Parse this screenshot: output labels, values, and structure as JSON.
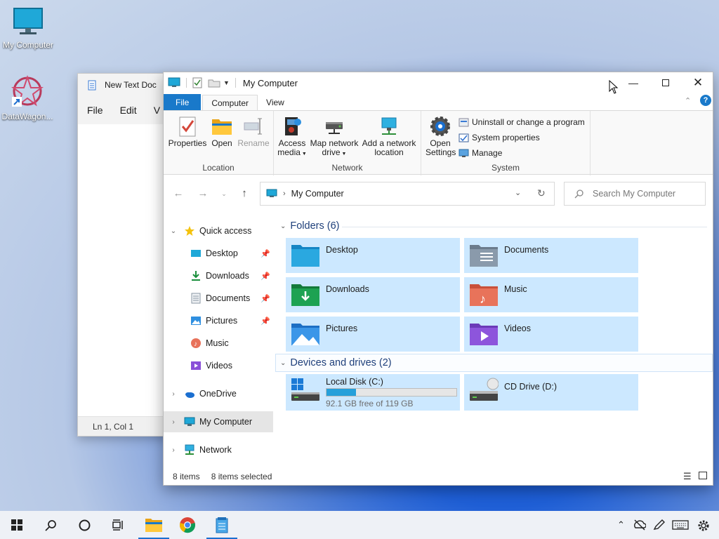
{
  "desktop": {
    "icons": [
      {
        "label": "My Computer",
        "icon": "monitor-icon"
      },
      {
        "label": "DataWagon...",
        "icon": "datawagon-app-icon"
      }
    ]
  },
  "notepad": {
    "title": "New Text Doc",
    "menu": [
      "File",
      "Edit",
      "V"
    ],
    "status": "Ln 1, Col 1"
  },
  "explorer": {
    "title": "My Computer",
    "tabs": {
      "file": "File",
      "computer": "Computer",
      "view": "View"
    },
    "ribbon": {
      "location": {
        "label": "Location",
        "properties": "Properties",
        "open": "Open",
        "rename": "Rename"
      },
      "network": {
        "label": "Network",
        "access_media": "Access",
        "access_media2": "media",
        "map_drive": "Map network",
        "map_drive2": "drive",
        "add_location": "Add a network",
        "add_location2": "location"
      },
      "system": {
        "label": "System",
        "open_settings": "Open",
        "open_settings2": "Settings",
        "uninstall": "Uninstall or change a program",
        "system_properties": "System properties",
        "manage": "Manage"
      }
    },
    "address": {
      "path": "My Computer"
    },
    "search": {
      "placeholder": "Search My Computer"
    },
    "tree": {
      "quick_access": "Quick access",
      "items": [
        {
          "label": "Desktop",
          "icon": "desktop-folder-icon"
        },
        {
          "label": "Downloads",
          "icon": "downloads-icon"
        },
        {
          "label": "Documents",
          "icon": "documents-icon"
        },
        {
          "label": "Pictures",
          "icon": "pictures-icon"
        },
        {
          "label": "Music",
          "icon": "music-icon"
        },
        {
          "label": "Videos",
          "icon": "videos-icon"
        }
      ],
      "onedrive": "OneDrive",
      "my_computer": "My Computer",
      "network": "Network"
    },
    "folders_header": "Folders (6)",
    "folders": [
      {
        "name": "Desktop",
        "icon": "desktop-folder-icon"
      },
      {
        "name": "Documents",
        "icon": "documents-folder-icon"
      },
      {
        "name": "Downloads",
        "icon": "downloads-folder-icon"
      },
      {
        "name": "Music",
        "icon": "music-folder-icon"
      },
      {
        "name": "Pictures",
        "icon": "pictures-folder-icon"
      },
      {
        "name": "Videos",
        "icon": "videos-folder-icon"
      }
    ],
    "drives_header": "Devices and drives (2)",
    "drives": [
      {
        "name": "Local Disk (C:)",
        "free": "92.1 GB free of 119 GB",
        "used_fraction": 0.226,
        "icon": "windows-drive-icon"
      },
      {
        "name": "CD Drive (D:)",
        "icon": "cd-drive-icon"
      }
    ],
    "status": {
      "items": "8 items",
      "selected": "8 items selected"
    }
  },
  "colors": {
    "accent": "#1979ca",
    "tile_bg": "#cce8ff",
    "selected_tree": "#e5e5e5"
  }
}
